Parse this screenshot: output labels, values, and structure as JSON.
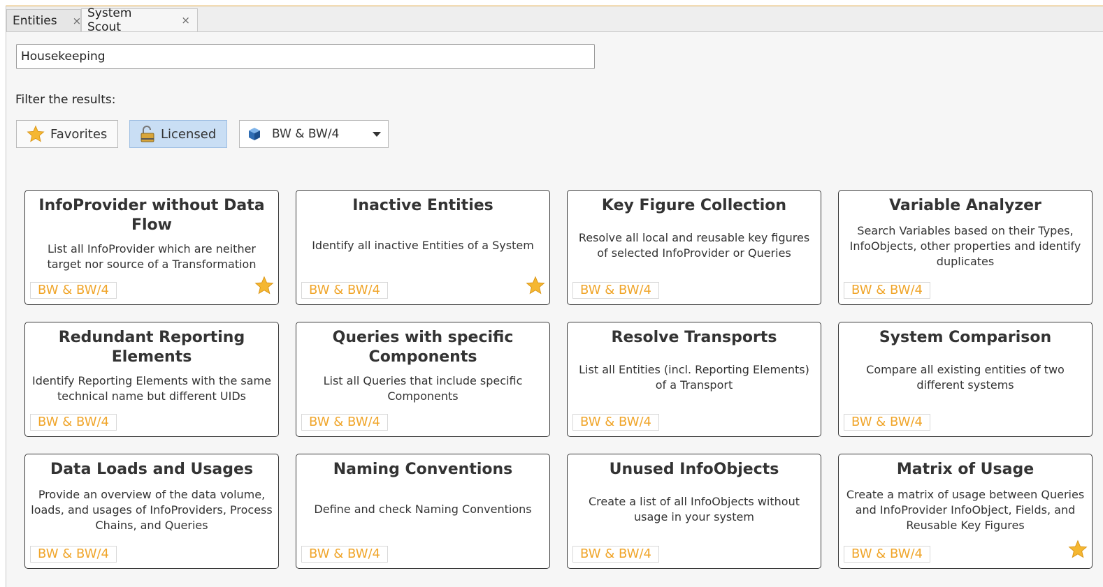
{
  "tabs": [
    {
      "label": "Entities",
      "close": "×"
    },
    {
      "label": "System Scout",
      "close": "×"
    }
  ],
  "search": {
    "value": "Housekeeping"
  },
  "filter": {
    "label": "Filter the results:",
    "favorites_label": "Favorites",
    "licensed_label": "Licensed",
    "system_value": "BW & BW/4"
  },
  "colors": {
    "accent": "#f0a52a",
    "active_filter": "#c9def4",
    "star": "#f5b731"
  },
  "cards": [
    {
      "title": "InfoProvider without Data Flow",
      "desc": "List all InfoProvider which are neither target nor source of a Transformation",
      "tag": "BW & BW/4",
      "favorite": true
    },
    {
      "title": "Inactive Entities",
      "desc": "Identify all inactive Entities of a System",
      "tag": "BW & BW/4",
      "favorite": true
    },
    {
      "title": "Key Figure Collection",
      "desc": "Resolve all local and reusable key figures of selected InfoProvider or Queries",
      "tag": "BW & BW/4",
      "favorite": false
    },
    {
      "title": "Variable Analyzer",
      "desc": "Search Variables based on their Types, InfoObjects, other properties and identify duplicates",
      "tag": "BW & BW/4",
      "favorite": false
    },
    {
      "title": "Redundant Reporting Elements",
      "desc": "Identify Reporting Elements with the same technical name but different UIDs",
      "tag": "BW & BW/4",
      "favorite": false
    },
    {
      "title": "Queries with specific Components",
      "desc": "List all Queries that include specific Components",
      "tag": "BW & BW/4",
      "favorite": false
    },
    {
      "title": "Resolve Transports",
      "desc": "List all Entities (incl. Reporting Elements) of a Transport",
      "tag": "BW & BW/4",
      "favorite": false
    },
    {
      "title": "System Comparison",
      "desc": "Compare all existing entities of two different systems",
      "tag": "BW & BW/4",
      "favorite": false
    },
    {
      "title": "Data Loads and Usages",
      "desc": "Provide an overview of the data volume, loads, and usages of InfoProviders, Process Chains, and Queries",
      "tag": "BW & BW/4",
      "favorite": false
    },
    {
      "title": "Naming Conventions",
      "desc": "Define and check Naming Conventions",
      "tag": "BW & BW/4",
      "favorite": false
    },
    {
      "title": "Unused InfoObjects",
      "desc": "Create a list of all InfoObjects without usage in your system",
      "tag": "BW & BW/4",
      "favorite": false
    },
    {
      "title": "Matrix of Usage",
      "desc": "Create a matrix of usage between Queries and InfoProvider InfoObject, Fields, and Reusable Key Figures",
      "tag": "BW & BW/4",
      "favorite": true
    }
  ]
}
